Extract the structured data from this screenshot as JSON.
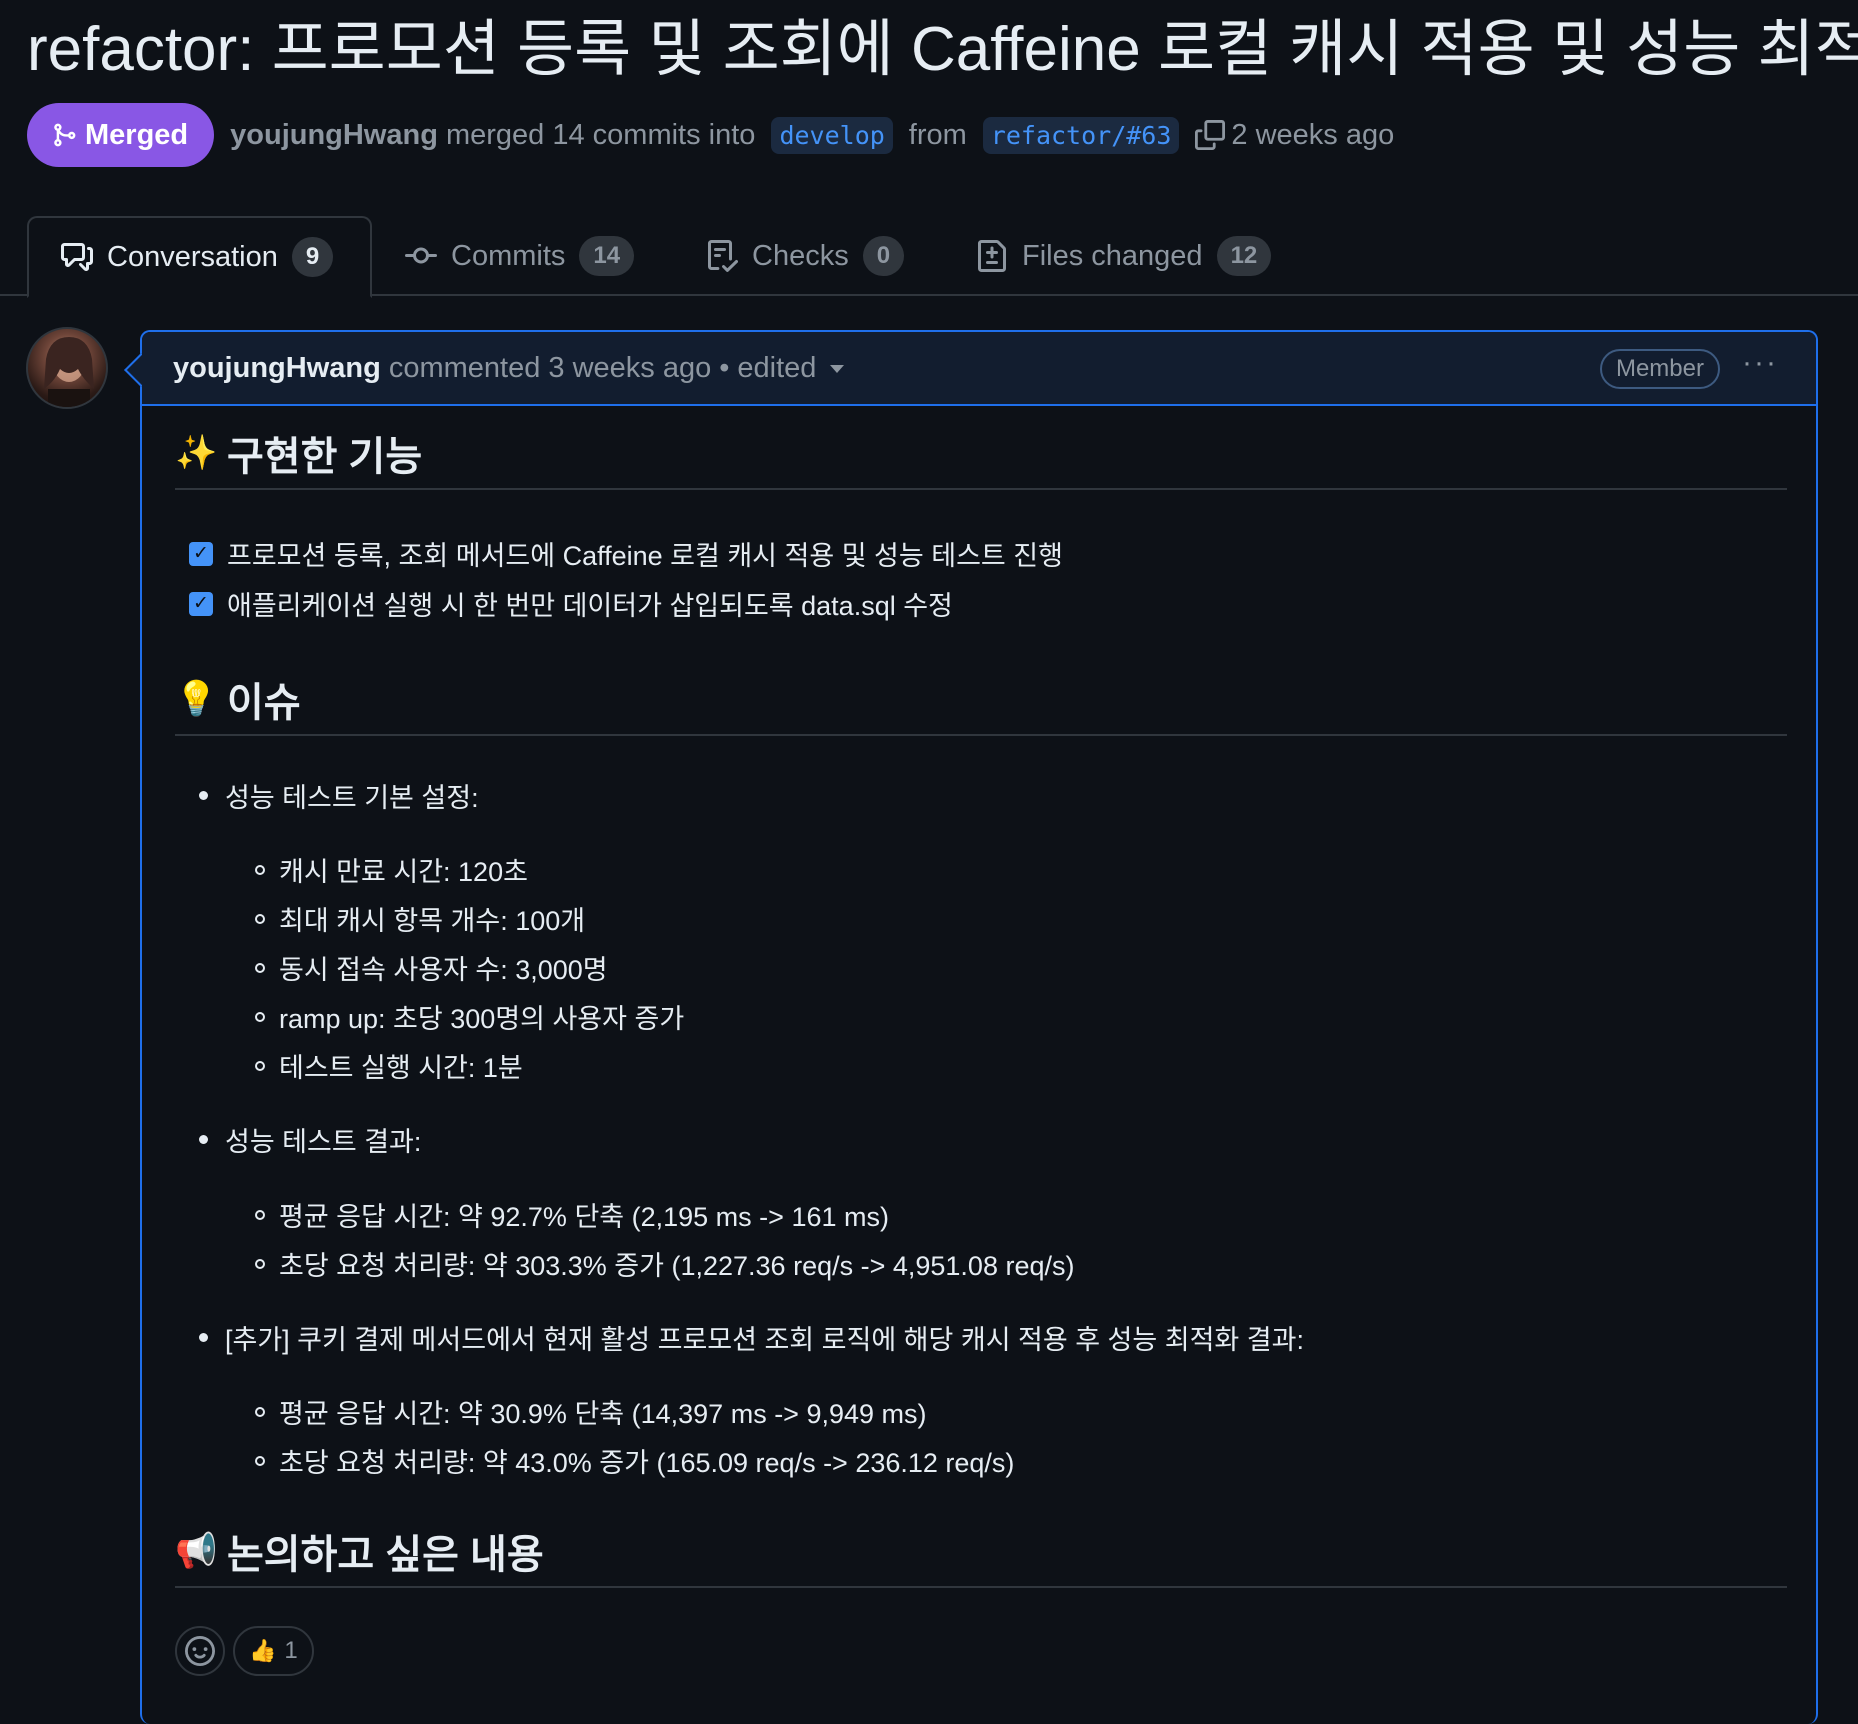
{
  "pr": {
    "title": "refactor: 프로모션 등록 및 조회에 Caffeine 로컬 캐시 적용 및 성능 최적화",
    "status": "Merged",
    "author": "youjungHwang",
    "merge_text": "merged 14 commits into",
    "base_branch": "develop",
    "from_text": "from",
    "head_branch": "refactor/#63",
    "time": "2 weeks ago"
  },
  "tabs": [
    {
      "label": "Conversation",
      "count": "9",
      "icon": "comment-discussion-icon"
    },
    {
      "label": "Commits",
      "count": "14",
      "icon": "git-commit-icon"
    },
    {
      "label": "Checks",
      "count": "0",
      "icon": "checklist-icon"
    },
    {
      "label": "Files changed",
      "count": "12",
      "icon": "file-diff-icon"
    }
  ],
  "comment": {
    "author": "youjungHwang",
    "action": "commented 3 weeks ago",
    "edited": "edited",
    "role_badge": "Member",
    "more": "···"
  },
  "body": {
    "section1": {
      "emoji": "✨",
      "title": "구현한 기능"
    },
    "tasks": [
      "프로모션 등록, 조회 메서드에 Caffeine 로컬 캐시 적용 및 성능 테스트 진행",
      "애플리케이션 실행 시 한 번만 데이터가 삽입되도록 data.sql 수정"
    ],
    "section2": {
      "emoji": "💡",
      "title": "이슈"
    },
    "group1": {
      "label": "성능 테스트 기본 설정:",
      "items": [
        "캐시 만료 시간: 120초",
        "최대 캐시 항목 개수: 100개",
        "동시 접속 사용자 수: 3,000명",
        "ramp up: 초당 300명의 사용자 증가",
        "테스트 실행 시간: 1분"
      ]
    },
    "group2": {
      "label": "성능 테스트 결과:",
      "items": [
        "평균 응답 시간: 약 92.7% 단축 (2,195 ms -> 161 ms)",
        "초당 요청 처리량: 약 303.3% 증가 (1,227.36 req/s -> 4,951.08 req/s)"
      ]
    },
    "group3": {
      "label": "[추가] 쿠키 결제 메서드에서 현재 활성 프로모션 조회 로직에 해당 캐시 적용 후 성능 최적화 결과:",
      "items": [
        "평균 응답 시간: 약 30.9% 단축 (14,397 ms -> 9,949 ms)",
        "초당 요청 처리량: 약 43.0% 증가 (165.09 req/s -> 236.12 req/s)"
      ]
    },
    "section3": {
      "emoji": "📢",
      "title": "논의하고 싶은 내용"
    }
  },
  "reactions": {
    "thumbs_up": {
      "emoji": "👍",
      "count": "1"
    }
  },
  "colors": {
    "background": "#0d1117",
    "merged": "#8957e5",
    "accent": "#1f6feb",
    "link": "#4493f8",
    "muted": "#8d96a0"
  }
}
